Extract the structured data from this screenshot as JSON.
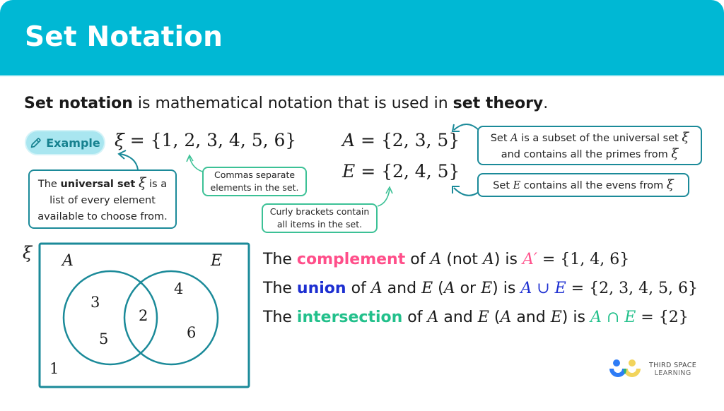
{
  "header": {
    "title": "Set Notation"
  },
  "intro": {
    "term": "Set notation",
    "middle": " is mathematical notation that is used in ",
    "term2": "set theory",
    "end": "."
  },
  "example_pill": {
    "icon": "pencil-icon",
    "label": "Example"
  },
  "equations": {
    "universal": {
      "symbol": "ξ",
      "eq": " = ",
      "set": "{1, 2, 3, 4, 5, 6}"
    },
    "set_a": {
      "symbol": "A",
      "eq": " = ",
      "set": "{2, 3, 5}"
    },
    "set_e": {
      "symbol": "E",
      "eq": " = ",
      "set": "{2, 4, 5}"
    }
  },
  "callouts": {
    "universal": {
      "pre": "The ",
      "bold": "universal set",
      "symbol": "ξ",
      "post": " is a",
      "line2": "list of every element",
      "line3": "available to choose from."
    },
    "commas": {
      "line1": "Commas separate",
      "line2": "elements in the set."
    },
    "curly": {
      "line1": "Curly brackets contain",
      "line2": "all items in the set."
    },
    "subset": {
      "pre": "Set ",
      "symbol": "A",
      "mid": " is a subset of the universal set ",
      "xi": "ξ",
      "line2": "and contains all the primes from ",
      "xi2": "ξ"
    },
    "evens": {
      "pre": "Set ",
      "symbol": "E",
      "mid": " contains all the evens from ",
      "xi": "ξ"
    }
  },
  "venn": {
    "universal_label": "ξ",
    "set_a_label": "A",
    "set_e_label": "E",
    "only_a": [
      "3",
      "5"
    ],
    "intersection": [
      "2"
    ],
    "only_e": [
      "4",
      "6"
    ],
    "outside": [
      "1"
    ]
  },
  "statements": [
    {
      "pre": "The ",
      "keyword": "complement",
      "p1": " of ",
      "v1": "A",
      "p2": "  (not ",
      "v2": "A",
      "p3": ") is ",
      "result_sym": "A′",
      "result": " = {1, 4, 6}"
    },
    {
      "pre": "The ",
      "keyword": "union",
      "p1": " of ",
      "v1": "A",
      "p2": " and ",
      "v2": "E",
      "p3": " (",
      "v3": "A",
      "p4": " or ",
      "v4": "E",
      "p5": ") is ",
      "result_sym": "A ∪ E",
      "result": " = {2, 3, 4, 5, 6}"
    },
    {
      "pre": "The ",
      "keyword": "intersection",
      "p1": " of ",
      "v1": "A",
      "p2": " and ",
      "v2": "E",
      "p3": " (",
      "v3": "A",
      "p4": " and ",
      "v4": "E",
      "p5": ") is ",
      "result_sym": "A ∩ E",
      "result": " = {2}"
    }
  ],
  "colors": {
    "header": "#00b8d4",
    "teal": "#1b8a99",
    "green": "#3cc196",
    "complement": "#ff4f8a",
    "union": "#1d2fd1",
    "intersection": "#22c08b"
  },
  "logo": {
    "line1": "THIRD SPACE",
    "line2": "LEARNING"
  }
}
